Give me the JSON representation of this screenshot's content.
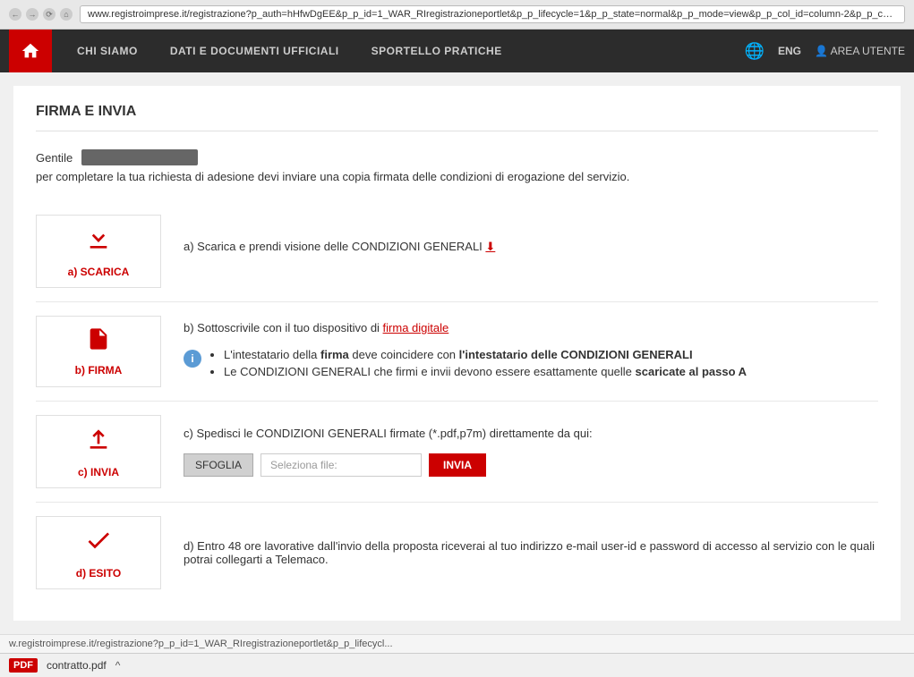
{
  "browser": {
    "url": "www.registroimprese.it/registrazione?p_auth=hHfwDgEE&p_p_id=1_WAR_RIregistrazioneportlet&p_p_lifecycle=1&p_p_state=normal&p_p_mode=view&p_p_col_id=column-2&p_p_col_..."
  },
  "nav": {
    "home_icon": "home",
    "items": [
      {
        "label": "CHI SIAMO"
      },
      {
        "label": "DATI E DOCUMENTI UFFICIALI"
      },
      {
        "label": "SPORTELLO PRATICHE"
      }
    ],
    "lang": "ENG",
    "area_utente": "AREA UTENTE"
  },
  "page": {
    "title": "FIRMA E INVIA",
    "greeting_label": "Gentile",
    "greeting_text": "per completare la tua richiesta di adesione devi inviare una copia firmata delle condizioni di erogazione del servizio."
  },
  "steps": [
    {
      "id": "a",
      "icon_label": "a) SCARICA",
      "description_before": "a) Scarica e prendi visione delle CONDIZIONI GENERALI ",
      "description_after": "",
      "has_link": true
    },
    {
      "id": "b",
      "icon_label": "b) FIRMA",
      "description": "b) Sottoscrivile con il tuo dispositivo di ",
      "link_text": "firma digitale",
      "info_items": [
        {
          "text_before": "L'intestatario della ",
          "bold1": "firma",
          "text_middle": " deve coincidere con ",
          "bold2": "l'intestatario delle CONDIZIONI GENERALI",
          "text_after": ""
        },
        {
          "text_before": "Le CONDIZIONI GENERALI che firmi e invii devono essere esattamente quelle ",
          "bold1": "scaricate al passo A",
          "text_after": ""
        }
      ]
    },
    {
      "id": "c",
      "icon_label": "c) INVIA",
      "description": "c) Spedisci le CONDIZIONI GENERALI firmate (*.pdf,p7m) direttamente da qui:",
      "sfoglia_label": "SFOGLIA",
      "file_placeholder": "Seleziona file:",
      "invia_label": "INVIA"
    },
    {
      "id": "d",
      "icon_label": "d) ESITO",
      "description": "d) Entro 48 ore lavorative dall'invio della proposta riceverai al tuo indirizzo e-mail user-id e password di accesso al servizio con le quali potrai collegarti a Telemaco."
    }
  ],
  "status_bar": {
    "url": "w.registroimprese.it/registrazione?p_p_id=1_WAR_RIregistrazioneportlet&p_p_lifecycl..."
  },
  "bottom_bar": {
    "pdf_label": "PDF",
    "filename": "contratto.pdf",
    "expand": "^"
  }
}
